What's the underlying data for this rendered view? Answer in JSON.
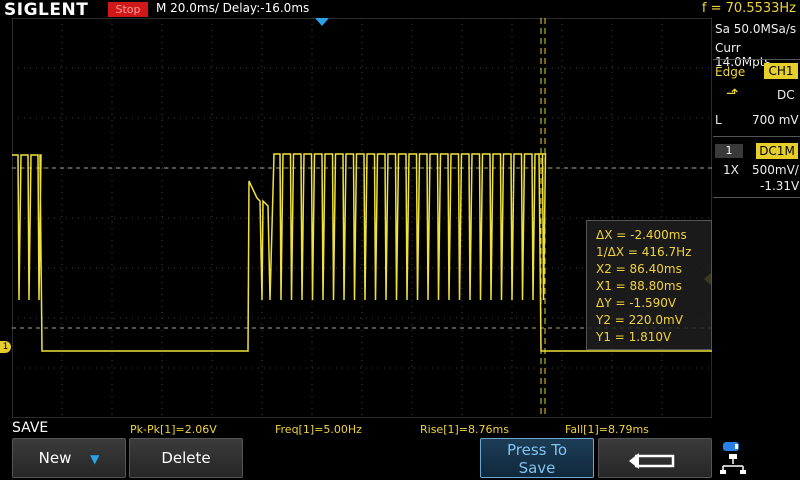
{
  "header": {
    "brand": "SIGLENT",
    "run_state": "Stop",
    "timebase": "M 20.0ms/ Delay:-16.0ms",
    "frequency": "f = 70.5533Hz"
  },
  "acquisition": {
    "sample_rate": "Sa 50.0MSa/s",
    "memory": "Curr 14.0Mpts"
  },
  "trigger": {
    "type": "Edge",
    "source": "CH1",
    "coupling": "DC",
    "level_label": "L",
    "level_value": "700 mV"
  },
  "channel": {
    "number": "1",
    "coupling_badge": "DC1M",
    "probe": "1X",
    "scale": "500mV/",
    "offset": "-1.31V",
    "marker": "1"
  },
  "cursors": {
    "dx": "ΔX = -2.400ms",
    "inv_dx": "1/ΔX = 416.7Hz",
    "x2": "X2 = 86.40ms",
    "x1": "X1 = 88.80ms",
    "dy": "ΔY = -1.590V",
    "y2": "Y2 = 220.0mV",
    "y1": "Y1 = 1.810V"
  },
  "measurements": {
    "pkpk": "Pk-Pk[1]=2.06V",
    "freq": "Freq[1]=5.00Hz",
    "rise": "Rise[1]=8.76ms",
    "fall": "Fall[1]=8.79ms"
  },
  "menu": {
    "title": "SAVE",
    "new_label": "New",
    "delete_label": "Delete",
    "press_line1": "Press To",
    "press_line2": "Save"
  },
  "colors": {
    "trace": "#f0e23a",
    "stop": "#d01818",
    "cursor_text": "#f0d23a"
  },
  "icons": [
    "down-arrow-icon",
    "return-arrow-icon",
    "network-icon",
    "trigger-slope-icon",
    "trigger-position-icon"
  ]
}
